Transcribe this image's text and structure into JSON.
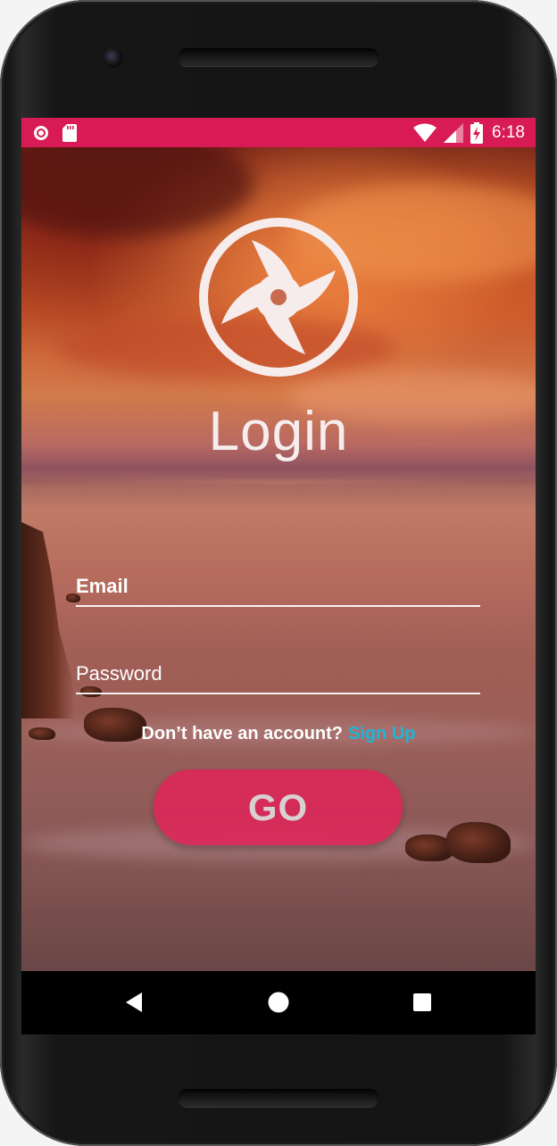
{
  "status_bar": {
    "time": "6:18",
    "icons": [
      "record-icon",
      "sd-card-icon",
      "wifi-icon",
      "signal-icon",
      "battery-charging-icon"
    ],
    "color": "#d81b55"
  },
  "login": {
    "logo_icon": "shuriken-logo-icon",
    "title": "Login",
    "email_label": "Email",
    "password_label": "Password",
    "signup_prompt": "Don’t have an account?",
    "signup_link": "Sign Up",
    "go_label": "GO",
    "accent_color": "#de2658",
    "link_color": "#1fb4d8"
  },
  "nav_bar": {
    "icons": [
      "back-icon",
      "home-icon",
      "recents-icon"
    ]
  }
}
